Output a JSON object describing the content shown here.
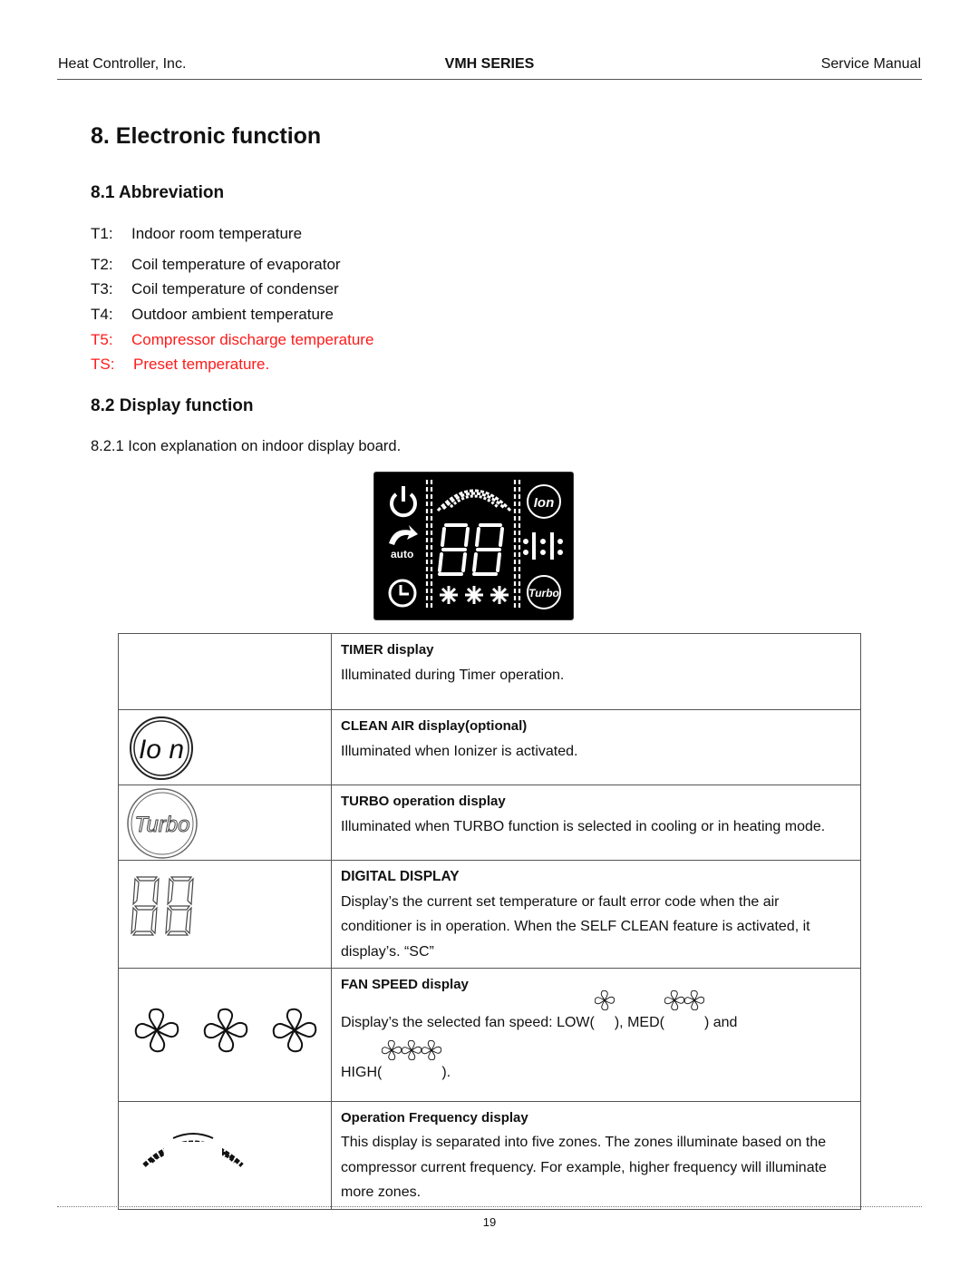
{
  "header": {
    "company": "Heat Controller, Inc.",
    "series": "VMH SERIES",
    "doc_type": "Service Manual"
  },
  "page_title": "8. Electronic function",
  "abbreviation": {
    "heading": "8.1 Abbreviation",
    "items": [
      {
        "code": "T1:",
        "text": "Indoor room temperature",
        "color": "#111111"
      },
      {
        "code": "T2:",
        "text": "Coil temperature of evaporator",
        "color": "#111111"
      },
      {
        "code": "T3:",
        "text": "Coil temperature of condenser",
        "color": "#111111"
      },
      {
        "code": "T4:",
        "text": "Outdoor ambient temperature",
        "color": "#111111"
      },
      {
        "code": "T5:",
        "text": "Compressor discharge temperature",
        "color": "#ff1a1a"
      },
      {
        "code": "TS:",
        "text": "Preset temperature.",
        "color": "#ff1a1a"
      }
    ]
  },
  "display_function": {
    "heading": "8.2 Display function",
    "intro": "8.2.1 Icon explanation on indoor display board.",
    "board": {
      "digits": "88",
      "ion_label": "Ion",
      "auto_label": "auto",
      "turbo_label": "Turbo"
    },
    "rows": [
      {
        "icon": "timer-icon",
        "title": "TIMER display",
        "body": "Illuminated during Timer operation."
      },
      {
        "icon": "ion-icon",
        "icon_label": "Io n",
        "title": "CLEAN AIR display(optional)",
        "body": "Illuminated when Ionizer is activated."
      },
      {
        "icon": "turbo-icon",
        "icon_label": "Turbo",
        "title": "TURBO operation display",
        "body": "Illuminated when TURBO function is selected in cooling or in heating mode."
      },
      {
        "icon": "digital-display-icon",
        "title": "DIGITAL DISPLAY",
        "body": "Display’s the current set temperature or fault error code when the air conditioner is in operation. When the SELF CLEAN feature is activated, it display’s. “SC”"
      },
      {
        "icon": "fan-speed-icon",
        "title": "FAN SPEED display",
        "body_parts": {
          "intro": "Display’s the selected fan speed: LOW(",
          "mid1": "), MED(",
          "mid2": ") and",
          "high": "HIGH(",
          "end": ")."
        }
      },
      {
        "icon": "frequency-arc-icon",
        "title": "Operation Frequency display",
        "body": "This display is separated into five zones. The zones illuminate based on the compressor current frequency. For example, higher frequency will illuminate more zones."
      }
    ]
  },
  "footer": {
    "page_number": "19"
  }
}
